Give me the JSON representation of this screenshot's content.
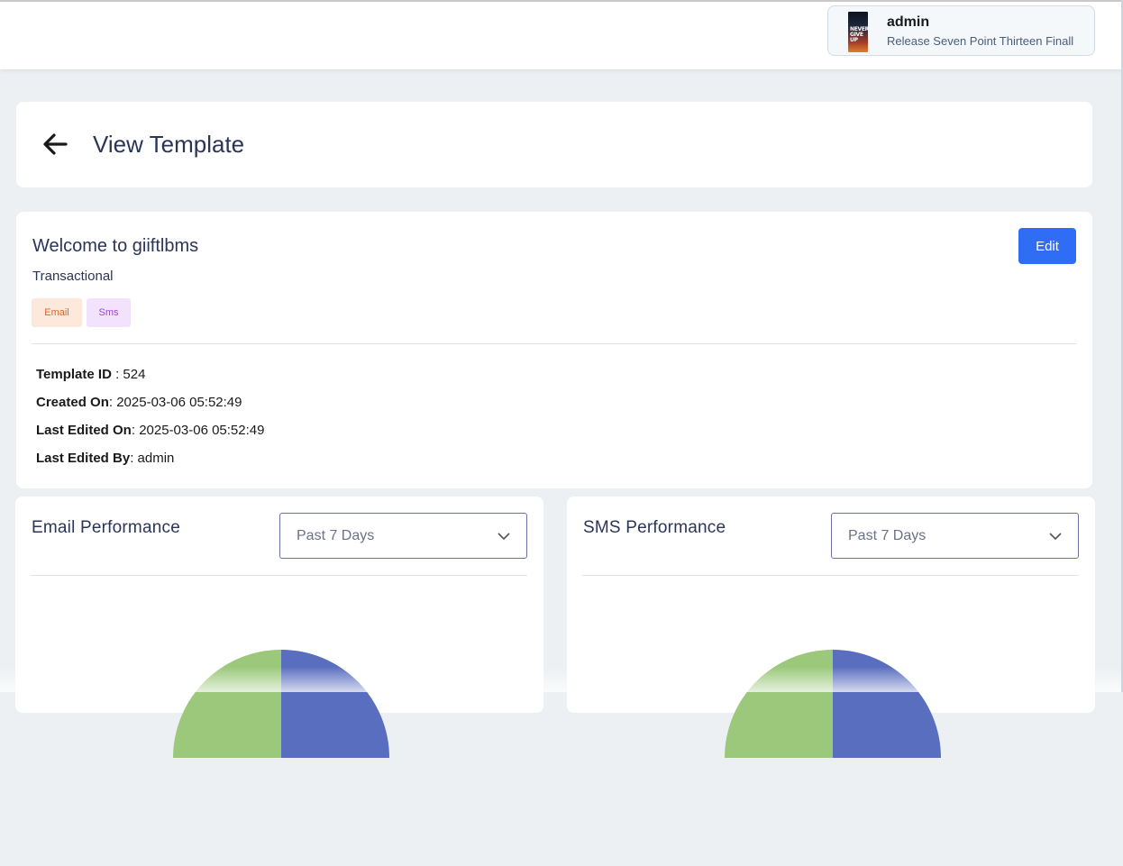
{
  "user": {
    "name": "admin",
    "subtitle": "Release Seven Point Thirteen Finall",
    "avatar_text": "NEVER GIVE UP"
  },
  "page": {
    "title": "View Template"
  },
  "template": {
    "name": "Welcome to giiftlbms",
    "type": "Transactional",
    "channels": [
      "Email",
      "Sms"
    ],
    "edit_label": "Edit",
    "details": [
      {
        "label": "Template ID",
        "sep": " : ",
        "value": "524"
      },
      {
        "label": "Created On",
        "sep": ": ",
        "value": "2025-03-06 05:52:49"
      },
      {
        "label": "Last Edited On",
        "sep": ": ",
        "value": "2025-03-06 05:52:49"
      },
      {
        "label": "Last Edited By",
        "sep": ": ",
        "value": "admin"
      }
    ]
  },
  "performance": {
    "email": {
      "title": "Email Performance",
      "period": "Past 7 Days"
    },
    "sms": {
      "title": "SMS Performance",
      "period": "Past 7 Days"
    }
  },
  "colors": {
    "accent": "#2f6df5",
    "pie_blue": "#5a6ebf",
    "pie_green": "#9bc87a"
  }
}
